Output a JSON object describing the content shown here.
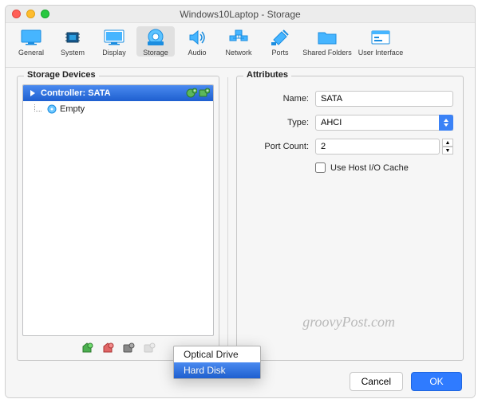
{
  "window": {
    "title": "Windows10Laptop - Storage"
  },
  "toolbar": {
    "items": [
      {
        "label": "General"
      },
      {
        "label": "System"
      },
      {
        "label": "Display"
      },
      {
        "label": "Storage"
      },
      {
        "label": "Audio"
      },
      {
        "label": "Network"
      },
      {
        "label": "Ports"
      },
      {
        "label": "Shared Folders"
      },
      {
        "label": "User Interface"
      }
    ]
  },
  "devices": {
    "group_title": "Storage Devices",
    "controller_label": "Controller: SATA",
    "empty_label": "Empty"
  },
  "attributes": {
    "group_title": "Attributes",
    "name_label": "Name:",
    "name_value": "SATA",
    "type_label": "Type:",
    "type_value": "AHCI",
    "portcount_label": "Port Count:",
    "portcount_value": "2",
    "hostio_label": "Use Host I/O Cache"
  },
  "popup": {
    "optical": "Optical Drive",
    "harddisk": "Hard Disk"
  },
  "buttons": {
    "cancel": "Cancel",
    "ok": "OK"
  },
  "watermark": "groovyPost.com"
}
